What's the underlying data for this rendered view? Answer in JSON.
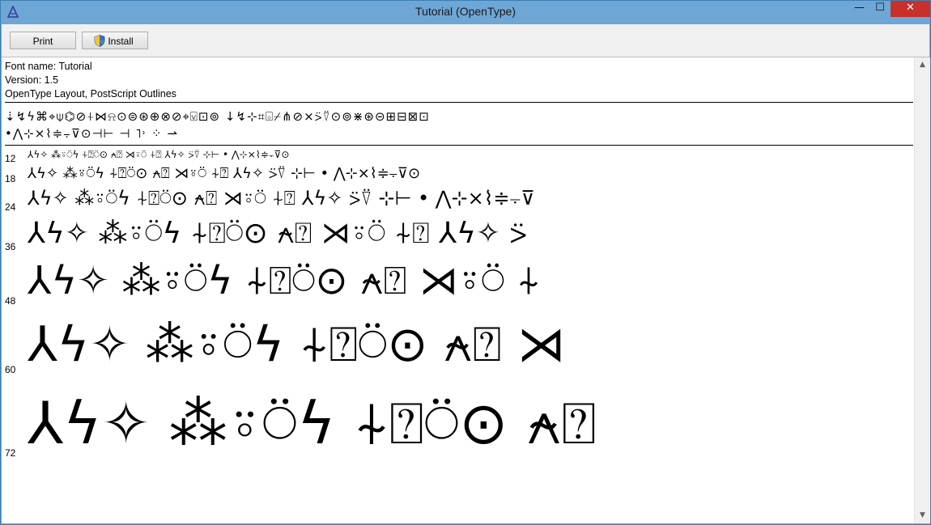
{
  "window": {
    "title": "Tutorial (OpenType)",
    "controls": {
      "minimize": "—",
      "maximize": "☐",
      "close": "✕"
    }
  },
  "toolbar": {
    "print_label": "Print",
    "install_label": "Install"
  },
  "font_info": {
    "name_line": "Font name: Tutorial",
    "version_line": "Version: 1.5",
    "type_line": "OpenType Layout, PostScript Outlines"
  },
  "charset": {
    "line1": "⇣↯ϟ⌘⌖⍦⌬⊘⍭⋈⍾⊙⊜⊛⊕⊗⊘⌖⍌⊡⊚  ↓↯⊹⌗⌺⌿⋔⊘⨯⍩⍢⊙⊚⋇⊛⊝⊞⊟⊠⊡",
    "line2": "•⋀⊹⨯⌇≑⨪⊽⊙⊣⊢  ⊣   ˥˒   ⁘      ⇀"
  },
  "samples": [
    {
      "size": "12",
      "text": "⅄ϟ✧ ⁂⍤⍥ϟ ⍭⍰⍥⊙ ⍲⍰ ⋊⍤⍥ ⍭⍰ ⅄ϟ✧ ⍩⍢ ⊹⊢ • ⋀⊹⨯⌇≑⨪⊽⊙"
    },
    {
      "size": "18",
      "text": "⅄ϟ✧ ⁂⍤⍥ϟ ⍭⍰⍥⊙ ⍲⍰ ⋊⍤⍥ ⍭⍰ ⅄ϟ✧ ⍩⍢ ⊹⊢ • ⋀⊹⨯⌇≑⨪⊽⊙"
    },
    {
      "size": "24",
      "text": "⅄ϟ✧ ⁂⍤⍥ϟ ⍭⍰⍥⊙ ⍲⍰ ⋊⍤⍥ ⍭⍰ ⅄ϟ✧ ⍩⍢ ⊹⊢ • ⋀⊹⨯⌇≑⨪⊽"
    },
    {
      "size": "36",
      "text": "⅄ϟ✧ ⁂⍤⍥ϟ ⍭⍰⍥⊙ ⍲⍰ ⋊⍤⍥ ⍭⍰ ⅄ϟ✧ ⍩"
    },
    {
      "size": "48",
      "text": "⅄ϟ✧ ⁂⍤⍥ϟ ⍭⍰⍥⊙ ⍲⍰ ⋊⍤⍥ ⍭"
    },
    {
      "size": "60",
      "text": "⅄ϟ✧ ⁂⍤⍥ϟ ⍭⍰⍥⊙ ⍲⍰ ⋊"
    },
    {
      "size": "72",
      "text": "⅄ϟ✧ ⁂⍤⍥ϟ ⍭⍰⍥⊙ ⍲⍰"
    }
  ]
}
